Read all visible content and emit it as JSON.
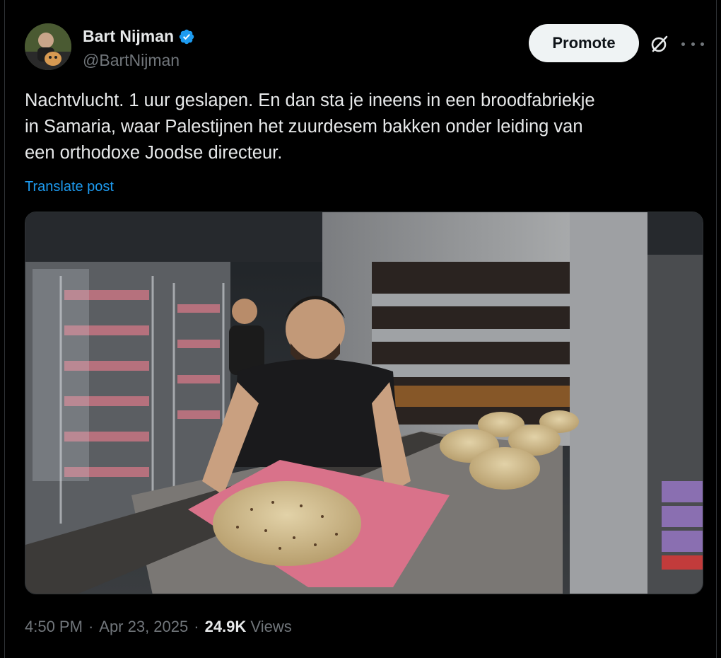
{
  "author": {
    "display_name": "Bart Nijman",
    "handle": "@BartNijman",
    "verified": true
  },
  "actions": {
    "promote_label": "Promote",
    "grok_icon": "grok-icon",
    "more_icon": "more-icon"
  },
  "post": {
    "text": "Nachtvlucht. 1 uur geslapen. En dan sta je ineens in een broodfabriekje\nin Samaria, waar Palestijnen het zuurdesem bakken onder leiding van\neen orthodoxe Joodse directeur.",
    "translate_label": "Translate post"
  },
  "media": {
    "image_description_icon": "photo-bakery-icon"
  },
  "meta": {
    "time": "4:50 PM",
    "separator": "·",
    "date": "Apr 23, 2025",
    "views_count": "24.9K",
    "views_label": "Views"
  },
  "colors": {
    "accent": "#1d9bf0",
    "background": "#000000",
    "text": "#e7e9ea",
    "muted": "#71767b"
  }
}
